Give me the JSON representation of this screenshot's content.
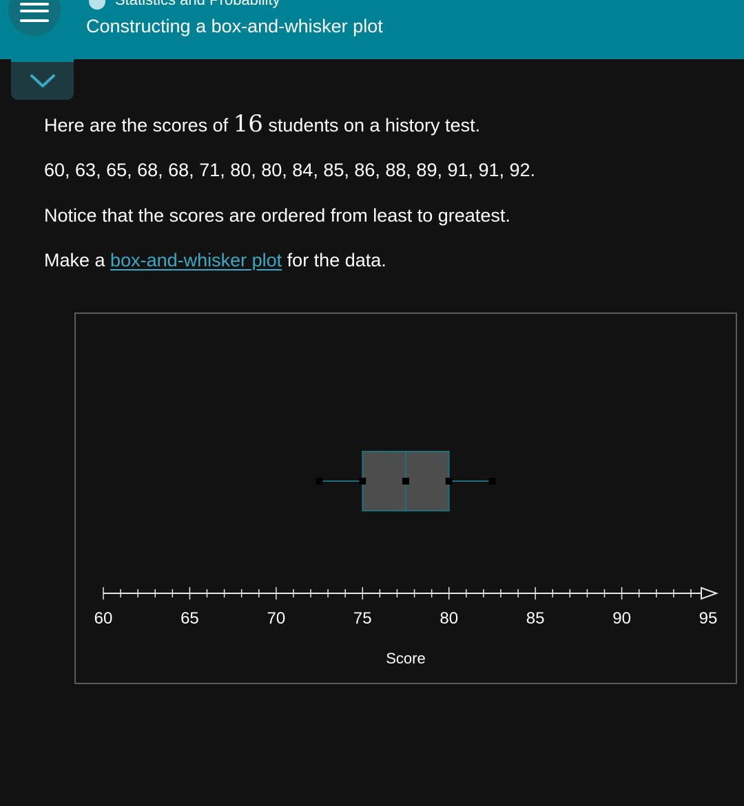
{
  "header": {
    "subject": "Statistics and Probability",
    "title": "Constructing a box-and-whisker plot"
  },
  "problem": {
    "intro_before": "Here are the scores of ",
    "count": "16",
    "intro_after": " students on a history test.",
    "scores_text": "60, 63, 65, 68, 68, 71, 80, 80, 84, 85, 86, 88, 89, 91, 91, 92.",
    "notice": "Notice that the scores are ordered from least to greatest.",
    "instruction_before": "Make a ",
    "instruction_link": "box-and-whisker plot",
    "instruction_after": " for the data."
  },
  "colors": {
    "header_bg": "#008294",
    "link": "#3ba9c3",
    "box_fill": "#4d4d4d",
    "box_stroke": "#1f6f7a"
  },
  "chart_data": {
    "type": "box",
    "xlabel": "Score",
    "xlim": [
      60,
      95
    ],
    "tick_labels": [
      "60",
      "65",
      "70",
      "75",
      "80",
      "85",
      "90",
      "95"
    ],
    "minor_tick_step": 1,
    "box": {
      "min": 72.5,
      "q1": 75,
      "median": 77.5,
      "q3": 80,
      "max": 82.5
    }
  }
}
